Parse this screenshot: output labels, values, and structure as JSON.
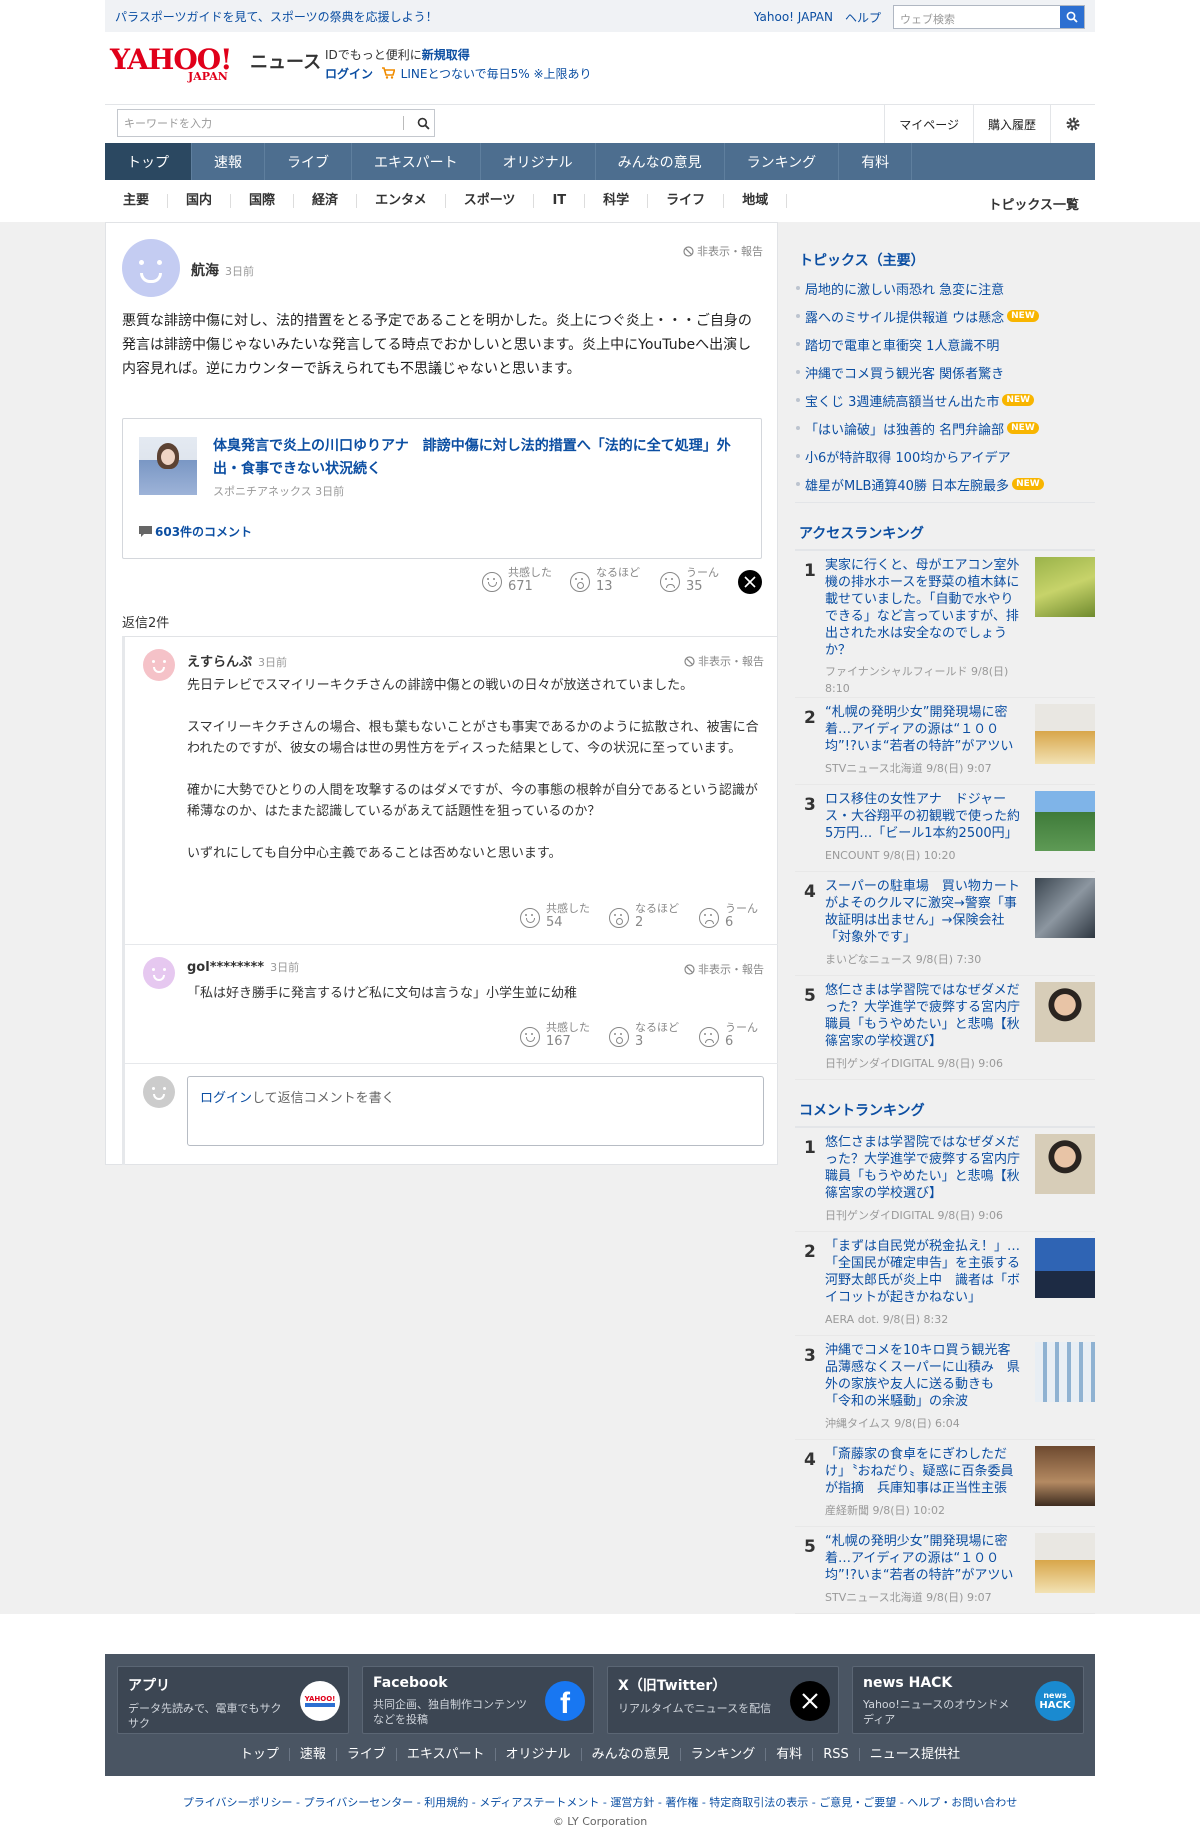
{
  "topbar": {
    "promo": "パラスポーツガイドを見て、スポーツの祭典を応援しよう！",
    "yahoo_japan": "Yahoo! JAPAN",
    "help": "ヘルプ",
    "web_search_placeholder": "ウェブ検索"
  },
  "header": {
    "logo_text": "YAHOO!",
    "logo_sub": "JAPAN",
    "news": "ニュース",
    "promo_line1_prefix": "IDでもっと便利に",
    "promo_line1_link": "新規取得",
    "login": "ログイン",
    "promo_line2": "LINEとつないで毎日5% ※上限あり",
    "keyword_placeholder": "キーワードを入力",
    "mypage": "マイページ",
    "purchase_history": "購入履歴"
  },
  "global_nav": [
    "トップ",
    "速報",
    "ライブ",
    "エキスパート",
    "オリジナル",
    "みんなの意見",
    "ランキング",
    "有料"
  ],
  "category_nav": [
    "主要",
    "国内",
    "国際",
    "経済",
    "エンタメ",
    "スポーツ",
    "IT",
    "科学",
    "ライフ",
    "地域"
  ],
  "topics_all": "トピックス一覧",
  "comment": {
    "user": "航海",
    "time": "3日前",
    "flag": "非表示・報告",
    "body": "悪質な誹謗中傷に対し、法的措置をとる予定であることを明かした。炎上につぐ炎上・・・ご自身の発言は誹謗中傷じゃないみたいな発言してる時点でおかしいと思います。炎上中にYouTubeへ出演し内容見れば。逆にカウンターで訴えられても不思議じゃないと思います。",
    "article": {
      "title": "体臭発言で炎上の川口ゆりアナ　誹謗中傷に対し法的措置へ「法的に全て処理」外出・食事できない状況続く",
      "source": "スポニチアネックス 3日前",
      "comments": "603件のコメント"
    },
    "reactions": {
      "empathy_label": "共感した",
      "empathy": "671",
      "naruhodo_label": "なるほど",
      "naruhodo": "13",
      "uun_label": "うーん",
      "uun": "35"
    },
    "replies_label": "返信2件"
  },
  "replies": [
    {
      "user": "えすらんぷ",
      "time": "3日前",
      "flag": "非表示・報告",
      "paragraphs": [
        "先日テレビでスマイリーキクチさんの誹謗中傷との戦いの日々が放送されていました。",
        "スマイリーキクチさんの場合、根も葉もないことがさも事実であるかのように拡散され、被害に合われたのですが、彼女の場合は世の男性方をディスった結果として、今の状況に至っています。",
        "確かに大勢でひとりの人間を攻撃するのはダメですが、今の事態の根幹が自分であるという認識が稀薄なのか、はたまた認識しているがあえて話題性を狙っているのか？",
        "いずれにしても自分中心主義であることは否めないと思います。"
      ],
      "reactions": {
        "empathy_label": "共感した",
        "empathy": "54",
        "naruhodo_label": "なるほど",
        "naruhodo": "2",
        "uun_label": "うーん",
        "uun": "6"
      }
    },
    {
      "user": "gol********",
      "time": "3日前",
      "flag": "非表示・報告",
      "paragraphs": [
        "「私は好き勝手に発言するけど私に文句は言うな」小学生並に幼稚"
      ],
      "reactions": {
        "empathy_label": "共感した",
        "empathy": "167",
        "naruhodo_label": "なるほど",
        "naruhodo": "3",
        "uun_label": "うーん",
        "uun": "6"
      }
    }
  ],
  "reply_box": {
    "login": "ログイン",
    "rest": "して返信コメントを書く"
  },
  "topics": {
    "heading": "トピックス（主要）",
    "new_label": "NEW",
    "items": [
      {
        "text": "局地的に激しい雨恐れ 急変に注意",
        "new": false
      },
      {
        "text": "露へのミサイル提供報道 ウは懸念",
        "new": true
      },
      {
        "text": "踏切で電車と車衝突 1人意識不明",
        "new": false
      },
      {
        "text": "沖縄でコメ買う観光客 関係者驚き",
        "new": false
      },
      {
        "text": "宝くじ 3週連続高額当せん出た市",
        "new": true
      },
      {
        "text": "「はい論破」は独善的 名門弁論部",
        "new": true
      },
      {
        "text": "小6が特許取得 100均からアイデア",
        "new": false
      },
      {
        "text": "雄星がMLB通算40勝 日本左腕最多",
        "new": true
      }
    ]
  },
  "access_ranking": {
    "heading": "アクセスランキング",
    "items": [
      {
        "num": "1",
        "title": "実家に行くと、母がエアコン室外機の排水ホースを野菜の植木鉢に載せていました。「自動で水やりできる」など言っていますが、排出された水は安全なのでしょうか？",
        "source": "ファイナンシャルフィールド 9/8(日) 8:10"
      },
      {
        "num": "2",
        "title": "“札幌の発明少女”開発現場に密着…アイディアの源は“１００均”!?いま“若者の特許”がアツい",
        "source": "STVニュース北海道 9/8(日) 9:07"
      },
      {
        "num": "3",
        "title": "ロス移住の女性アナ　ドジャース・大谷翔平の初観戦で使った約5万円…「ビール1本約2500円」",
        "source": "ENCOUNT 9/8(日) 10:20"
      },
      {
        "num": "4",
        "title": "スーパーの駐車場　買い物カートがよそのクルマに激突→警察「事故証明は出ません」→保険会社「対象外です」",
        "source": "まいどなニュース 9/8(日) 7:30"
      },
      {
        "num": "5",
        "title": "悠仁さまは学習院ではなぜダメだった？大学進学で疲弊する宮内庁職員「もうやめたい」と悲鳴【秋篠宮家の学校選び】",
        "source": "日刊ゲンダイDIGITAL 9/8(日) 9:06"
      }
    ]
  },
  "comment_ranking": {
    "heading": "コメントランキング",
    "items": [
      {
        "num": "1",
        "title": "悠仁さまは学習院ではなぜダメだった？大学進学で疲弊する宮内庁職員「もうやめたい」と悲鳴【秋篠宮家の学校選び】",
        "source": "日刊ゲンダイDIGITAL 9/8(日) 9:06"
      },
      {
        "num": "2",
        "title": "「まずは自民党が税金払え！」…「全国民が確定申告」を主張する河野太郎氏が炎上中　識者は「ボイコットが起きかねない」",
        "source": "AERA dot. 9/8(日) 8:32"
      },
      {
        "num": "3",
        "title": "沖縄でコメを10キロ買う観光客　品薄感なくスーパーに山積み　県外の家族や友人に送る動きも　「令和の米騒動」の余波",
        "source": "沖縄タイムス 9/8(日) 6:04"
      },
      {
        "num": "4",
        "title": "「斎藤家の食卓をにぎわしただけ」〝おねだり〟疑惑に百条委員が指摘　兵庫知事は正当性主張",
        "source": "産経新聞 9/8(日) 10:02"
      },
      {
        "num": "5",
        "title": "“札幌の発明少女”開発現場に密着…アイディアの源は“１００均”!?いま“若者の特許”がアツい",
        "source": "STVニュース北海道 9/8(日) 9:07"
      }
    ]
  },
  "footer": {
    "cards": [
      {
        "title": "アプリ",
        "desc": "データ先読みで、電車でもサクサク"
      },
      {
        "title": "Facebook",
        "desc": "共同企画、独自制作コンテンツなどを投稿"
      },
      {
        "title": "X（旧Twitter）",
        "desc": "リアルタイムでニュースを配信"
      },
      {
        "title": "news HACK",
        "desc": "Yahoo!ニュースのオウンドメディア"
      }
    ],
    "app_icon_text": "YAHOO!",
    "hack_icon_line1": "news",
    "hack_icon_line2": "HACK",
    "nav": [
      "トップ",
      "速報",
      "ライブ",
      "エキスパート",
      "オリジナル",
      "みんなの意見",
      "ランキング",
      "有料",
      "RSS",
      "ニュース提供社"
    ],
    "links": "プライバシーポリシー - プライバシーセンター - 利用規約 - メディアステートメント - 運営方針 - 著作権 - 特定商取引法の表示 - ご意見・ご要望 - ヘルプ・お問い合わせ",
    "copyright": "© LY Corporation"
  },
  "colors": {
    "link": "#0b4ea2",
    "nav_bg": "#4d6e8f",
    "nav_active": "#2b4861",
    "new_badge": "#f8b500",
    "brand_red": "#e0001a",
    "footer_bg": "#4a5563"
  }
}
